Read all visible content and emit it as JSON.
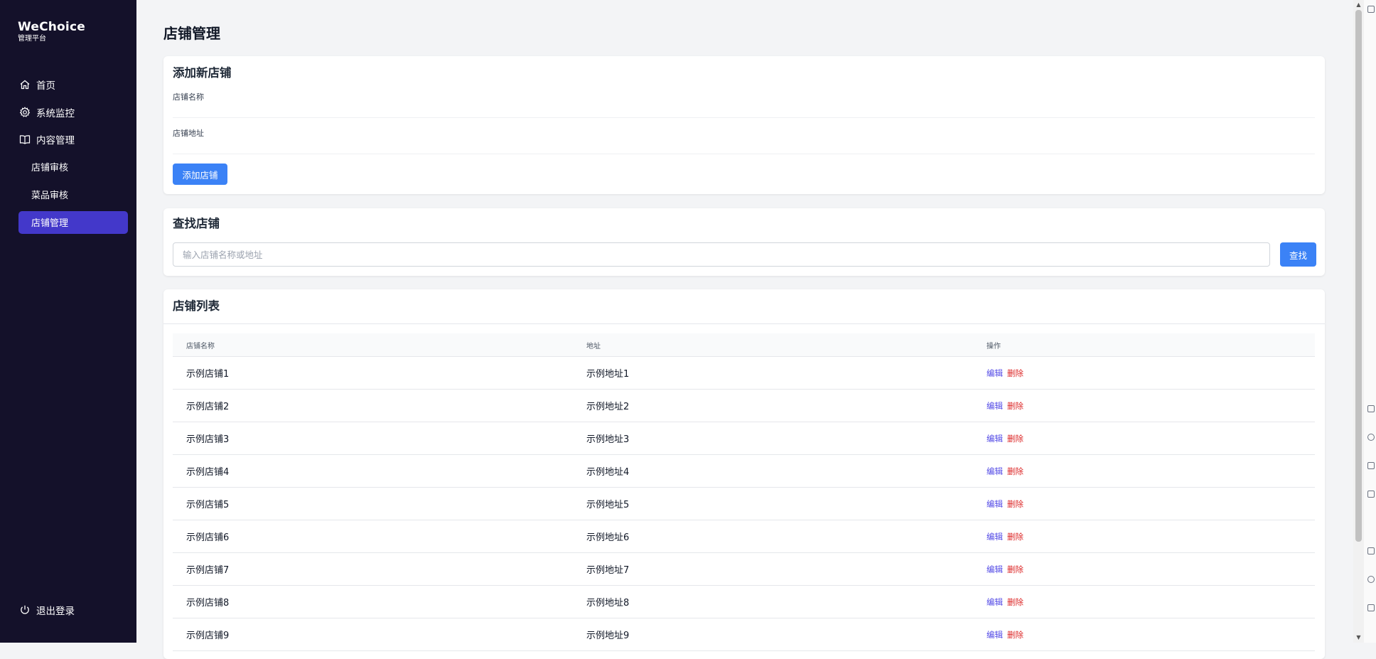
{
  "brand": {
    "title": "WeChoice",
    "subtitle": "管理平台"
  },
  "sidebar": {
    "items": [
      {
        "label": "首页",
        "icon": "home-icon"
      },
      {
        "label": "系统监控",
        "icon": "gear-icon"
      },
      {
        "label": "内容管理",
        "icon": "book-icon"
      }
    ],
    "subitems": [
      {
        "label": "店铺审核",
        "active": false
      },
      {
        "label": "菜品审核",
        "active": false
      },
      {
        "label": "店铺管理",
        "active": true
      }
    ],
    "logout": {
      "label": "退出登录",
      "icon": "power-icon"
    }
  },
  "page": {
    "title": "店铺管理"
  },
  "add_card": {
    "title": "添加新店铺",
    "name_label": "店铺名称",
    "address_label": "店铺地址",
    "name_value": "",
    "address_value": "",
    "button": "添加店铺"
  },
  "search_card": {
    "title": "查找店铺",
    "placeholder": "输入店铺名称或地址",
    "value": "",
    "button": "查找"
  },
  "list_card": {
    "title": "店铺列表",
    "headers": [
      "店铺名称",
      "地址",
      "操作"
    ],
    "edit_label": "编辑",
    "delete_label": "删除",
    "rows": [
      {
        "name": "示例店铺1",
        "address": "示例地址1"
      },
      {
        "name": "示例店铺2",
        "address": "示例地址2"
      },
      {
        "name": "示例店铺3",
        "address": "示例地址3"
      },
      {
        "name": "示例店铺4",
        "address": "示例地址4"
      },
      {
        "name": "示例店铺5",
        "address": "示例地址5"
      },
      {
        "name": "示例店铺6",
        "address": "示例地址6"
      },
      {
        "name": "示例店铺7",
        "address": "示例地址7"
      },
      {
        "name": "示例店铺8",
        "address": "示例地址8"
      },
      {
        "name": "示例店铺9",
        "address": "示例地址9"
      }
    ]
  },
  "colors": {
    "sidebar_bg": "#14112a",
    "active_item": "#4338ca",
    "primary_button": "#3b82f6",
    "edit_link": "#4f46e5",
    "delete_link": "#dc2626"
  }
}
